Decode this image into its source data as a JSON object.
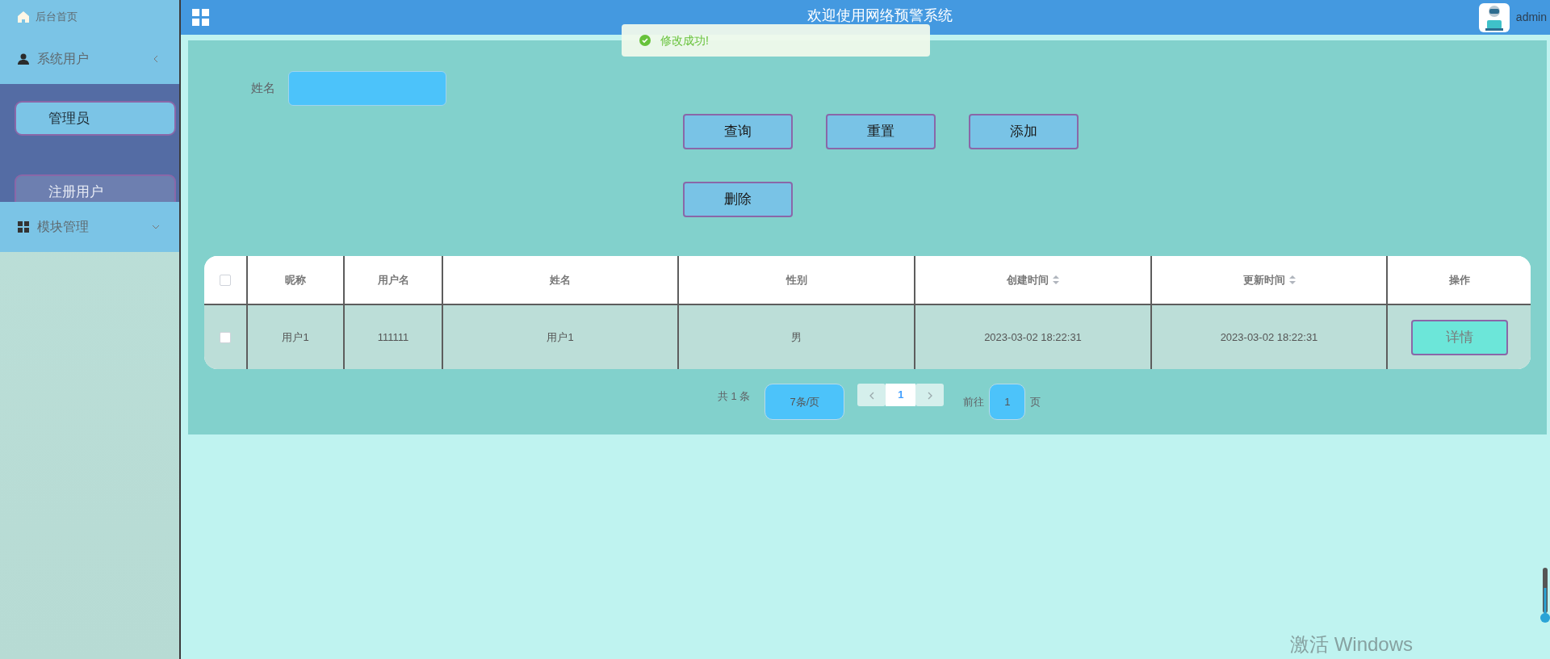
{
  "header": {
    "title": "欢迎使用网络预警系统",
    "username": "admin"
  },
  "toast": {
    "message": "修改成功!"
  },
  "sidebar": {
    "items": [
      {
        "kind": "link",
        "label": "后台首页"
      },
      {
        "kind": "group",
        "label": "系统用户",
        "expanded": true,
        "children": [
          {
            "label": "管理员",
            "selected": true
          },
          {
            "label": "注册用户",
            "selected": false
          }
        ]
      },
      {
        "kind": "group",
        "label": "模块管理",
        "expanded": false
      }
    ]
  },
  "search": {
    "fields": [
      {
        "label": "姓名"
      }
    ]
  },
  "buttons": [
    {
      "label": "查询"
    },
    {
      "label": "重置"
    },
    {
      "label": "添加"
    },
    {
      "label": "删除"
    }
  ],
  "table": {
    "select_all": {
      "checked": false
    },
    "columns": [
      {
        "label": "昵称"
      },
      {
        "label": "用户名"
      },
      {
        "label": "姓名"
      },
      {
        "label": "性别"
      },
      {
        "label": "创建时间",
        "sortable": true
      },
      {
        "label": "更新时间",
        "sortable": true
      },
      {
        "label": "操作"
      }
    ],
    "rows": [
      {
        "checked": false,
        "cells": [
          "用户1",
          "111111",
          "用户1",
          "男",
          "2023-03-02 18:22:31",
          "2023-03-02 18:22:31"
        ],
        "action": "详情"
      }
    ]
  },
  "pagination": {
    "total": "共 1 条",
    "page_size": "7条/页",
    "pages": [
      {
        "label": "1",
        "selected": true
      }
    ],
    "goto_label": "前往",
    "goto_value": "1",
    "page_suffix": "页"
  },
  "os_notice": "激活 Windows"
}
